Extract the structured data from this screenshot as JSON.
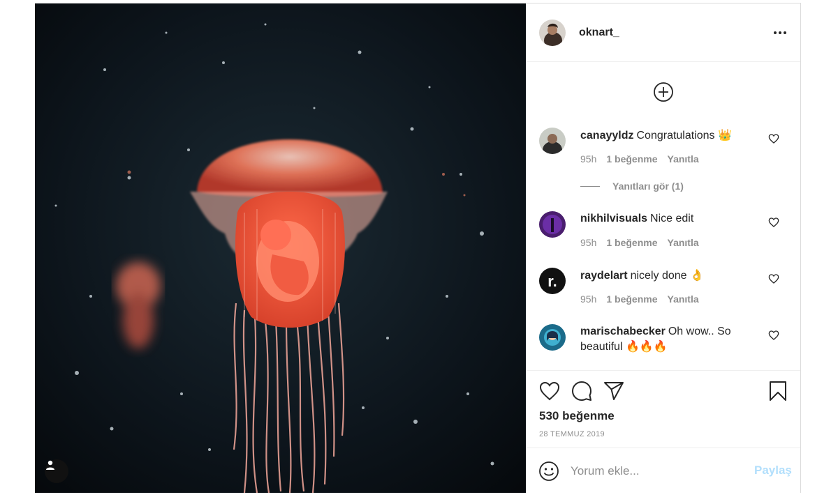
{
  "post": {
    "author": "oknart_",
    "likes_text": "530 beğenme",
    "date": "28 TEMMUZ 2019"
  },
  "comments": [
    {
      "user": "canayyldz",
      "text": "Congratulations",
      "emoji": "👑",
      "age": "95h",
      "likes": "1 beğenme",
      "reply": "Yanıtla"
    },
    {
      "user": "nikhilvisuals",
      "text": "Nice edit",
      "emoji": "",
      "age": "95h",
      "likes": "1 beğenme",
      "reply": "Yanıtla"
    },
    {
      "user": "raydelart",
      "text": "nicely done",
      "emoji": "👌",
      "age": "95h",
      "likes": "1 beğenme",
      "reply": "Yanıtla"
    },
    {
      "user": "marischabecker",
      "text": "Oh wow.. So beautiful",
      "emoji": "🔥🔥🔥",
      "age": "",
      "likes": "",
      "reply": ""
    }
  ],
  "view_replies": "Yanıtları gör (1)",
  "comment_box": {
    "placeholder": "Yorum ekle...",
    "post_label": "Paylaş"
  },
  "colors": {
    "link_disabled": "#b2dffc",
    "muted": "#8e8e8e",
    "text": "#262626"
  }
}
